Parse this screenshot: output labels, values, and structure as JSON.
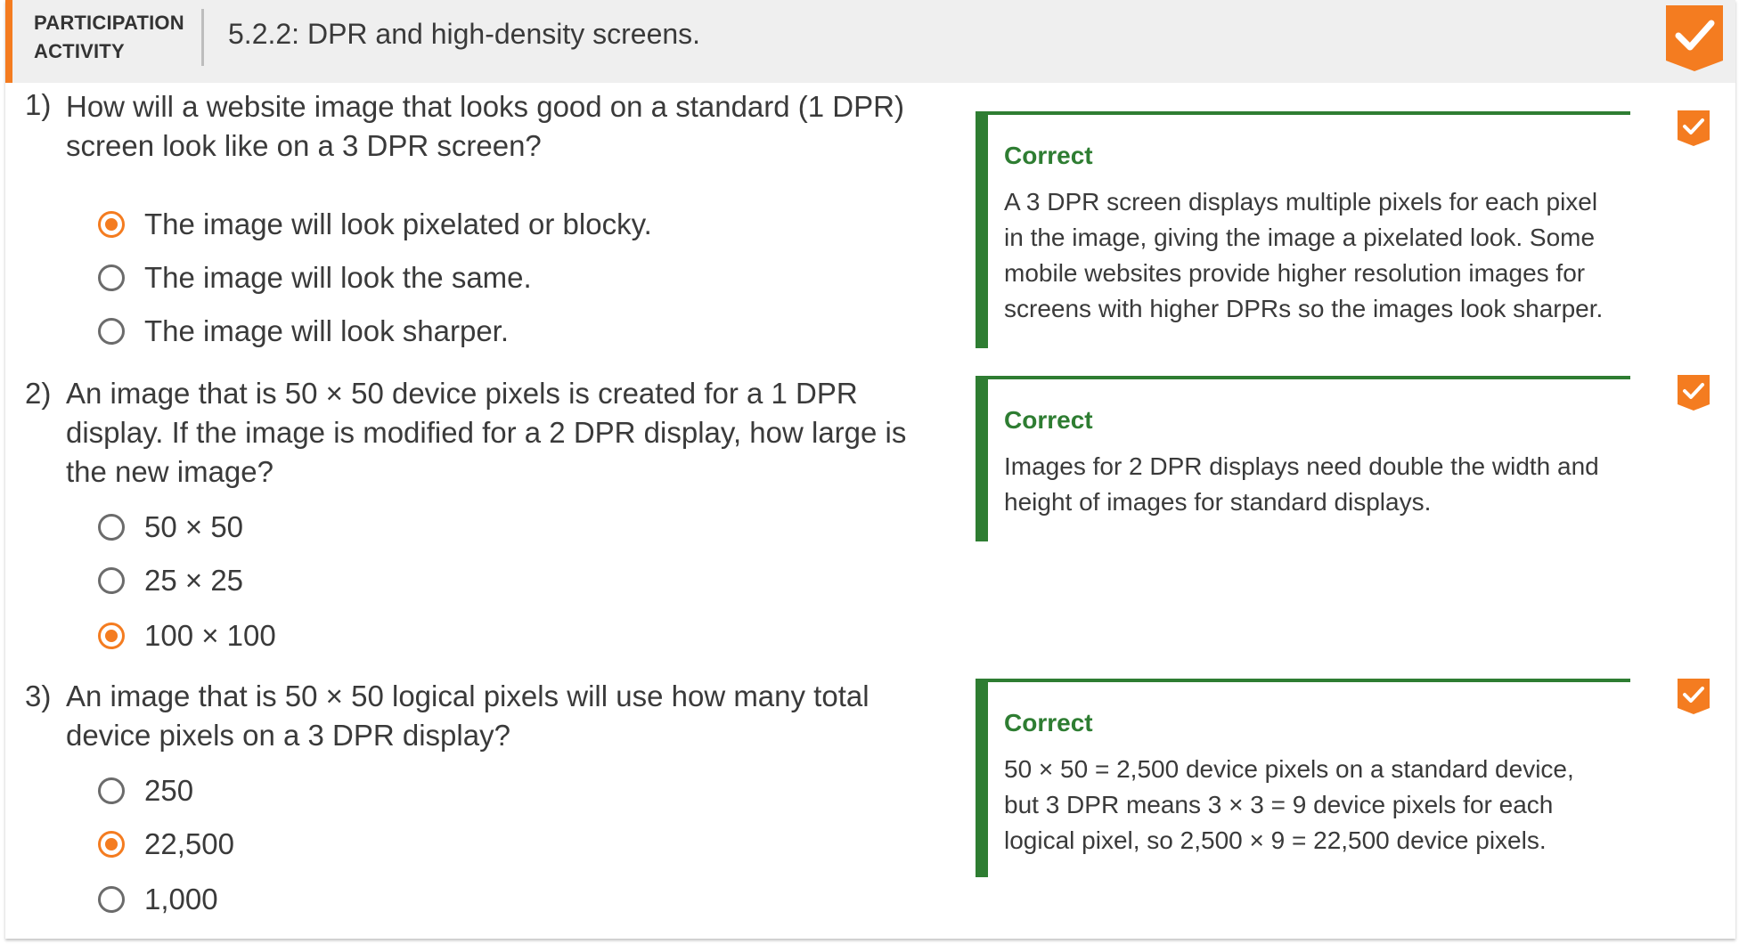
{
  "header": {
    "label_line1": "PARTICIPATION",
    "label_line2": "ACTIVITY",
    "title": "5.2.2: DPR and high-density screens.",
    "accent_color": "#f47c20",
    "badge_icon": "check-icon"
  },
  "questions": [
    {
      "number": "1)",
      "text": "How will a website image that looks good on a standard (1 DPR) screen look like on a 3 DPR screen?",
      "choices": [
        {
          "label": "The image will look pixelated or blocky.",
          "selected": true
        },
        {
          "label": "The image will look the same.",
          "selected": false
        },
        {
          "label": "The image will look sharper.",
          "selected": false
        }
      ],
      "feedback": {
        "title": "Correct",
        "text": "A 3 DPR screen displays multiple pixels for each pixel in the image, giving the image a pixelated look. Some mobile websites provide higher resolution images for screens with higher DPRs so the images look sharper."
      }
    },
    {
      "number": "2)",
      "text": "An image that is 50 × 50 device pixels is created for a 1 DPR display. If the image is modified for a 2 DPR display, how large is the new image?",
      "choices": [
        {
          "label": "50 × 50",
          "selected": false
        },
        {
          "label": "25 × 25",
          "selected": false
        },
        {
          "label": "100 × 100",
          "selected": true
        }
      ],
      "feedback": {
        "title": "Correct",
        "text": "Images for 2 DPR displays need double the width and height of images for standard displays."
      }
    },
    {
      "number": "3)",
      "text": "An image that is 50 × 50 logical pixels will use how many total device pixels on a 3 DPR display?",
      "choices": [
        {
          "label": "250",
          "selected": false
        },
        {
          "label": "22,500",
          "selected": true
        },
        {
          "label": "1,000",
          "selected": false
        }
      ],
      "feedback": {
        "title": "Correct",
        "text": "50 × 50 = 2,500 device pixels on a standard device, but 3 DPR means 3 × 3 = 9 device pixels for each logical pixel, so 2,500 × 9 = 22,500 device pixels."
      }
    }
  ],
  "colors": {
    "accent": "#f47c20",
    "correct_green": "#2e7d32",
    "header_bg": "#efefef"
  }
}
